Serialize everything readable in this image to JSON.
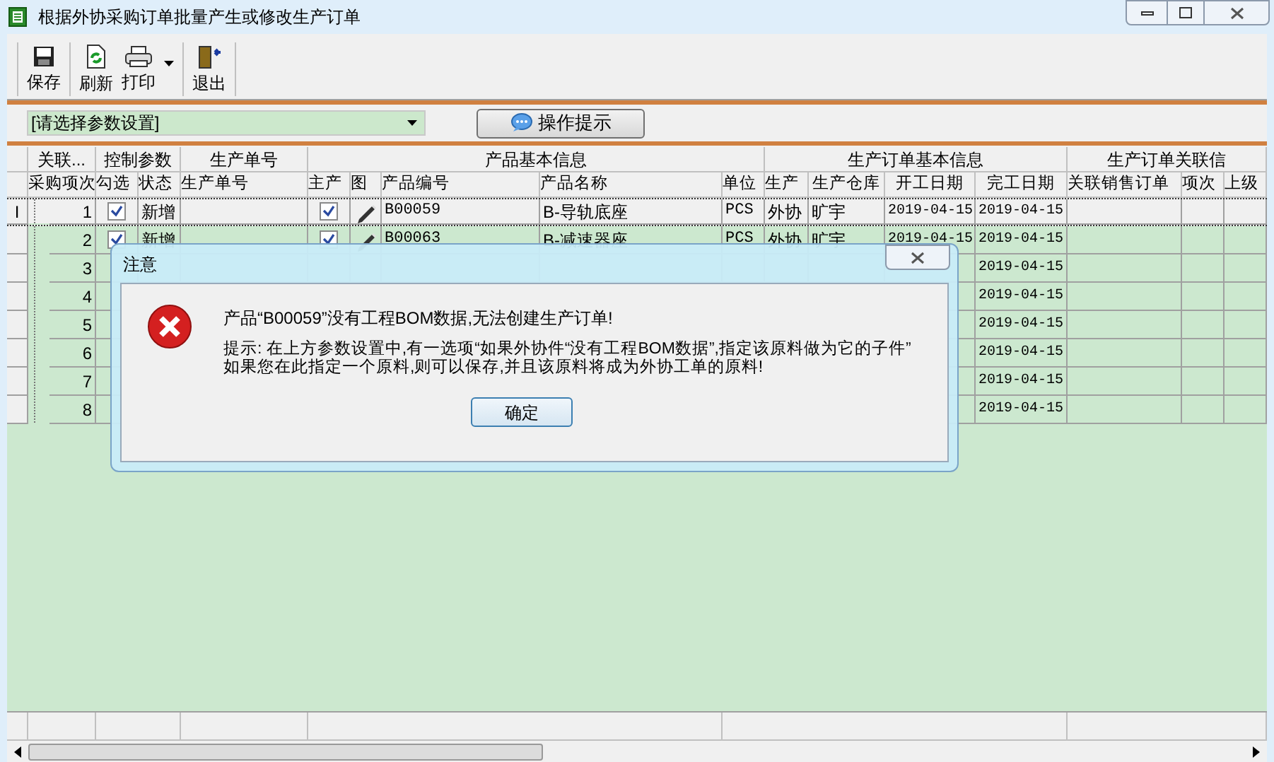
{
  "window": {
    "title": "根据外协采购订单批量产生或修改生产订单"
  },
  "toolbar": [
    {
      "label": "保存",
      "kind": "save"
    },
    {
      "label": "刷新",
      "kind": "refresh"
    },
    {
      "label": "打印",
      "kind": "print"
    },
    {
      "label": "退出",
      "kind": "exit"
    }
  ],
  "param_select": {
    "value": "[请选择参数设置]"
  },
  "hint_button": {
    "label": "操作提示"
  },
  "table": {
    "groups": [
      "关联...",
      "控制参数",
      "生产单号",
      "产品基本信息",
      "生产订单基本信息",
      "生产订单关联信"
    ],
    "columns": [
      "采购项次",
      "勾选",
      "状态",
      "生产单号",
      "主产",
      "图",
      "产品编号",
      "产品名称",
      "单位",
      "生产",
      "生产仓库",
      "开工日期",
      "完工日期",
      "关联销售订单",
      "项次",
      "上级"
    ],
    "rows": [
      {
        "marker": "I",
        "index": "1",
        "checked": true,
        "status": "新增",
        "main": true,
        "code": "B00059",
        "name": "B-导轨底座",
        "unit": "PCS",
        "mode": "外协",
        "warehouse": "旷宇",
        "start": "2019-04-15",
        "end": "2019-04-15",
        "selected": true
      },
      {
        "index": "2",
        "checked": true,
        "status": "新增",
        "main": true,
        "code": "B00063",
        "name": "B-减速器座",
        "unit": "PCS",
        "mode": "外协",
        "warehouse": "旷宇",
        "start": "2019-04-15",
        "end": "2019-04-15",
        "selected": false
      },
      {
        "index": "3",
        "end": "2019-04-15",
        "selected": false
      },
      {
        "index": "4",
        "end": "2019-04-15",
        "selected": false
      },
      {
        "index": "5",
        "end": "2019-04-15",
        "selected": false
      },
      {
        "index": "6",
        "end": "2019-04-15",
        "selected": false
      },
      {
        "index": "7",
        "end": "2019-04-15",
        "selected": false
      },
      {
        "index": "8",
        "end": "2019-04-15",
        "selected": false
      }
    ]
  },
  "dialog": {
    "title": "注意",
    "message": "产品“B00059”没有工程BOM数据,无法创建生产订单!",
    "hint_lines": [
      "提示: 在上方参数设置中,有一选项“如果外协件“没有工程BOM数据”,指定该原料做为它的子件”",
      "如果您在此指定一个原料,则可以保存,并且该原料将成为外协工单的原料!"
    ],
    "ok": "确定"
  }
}
